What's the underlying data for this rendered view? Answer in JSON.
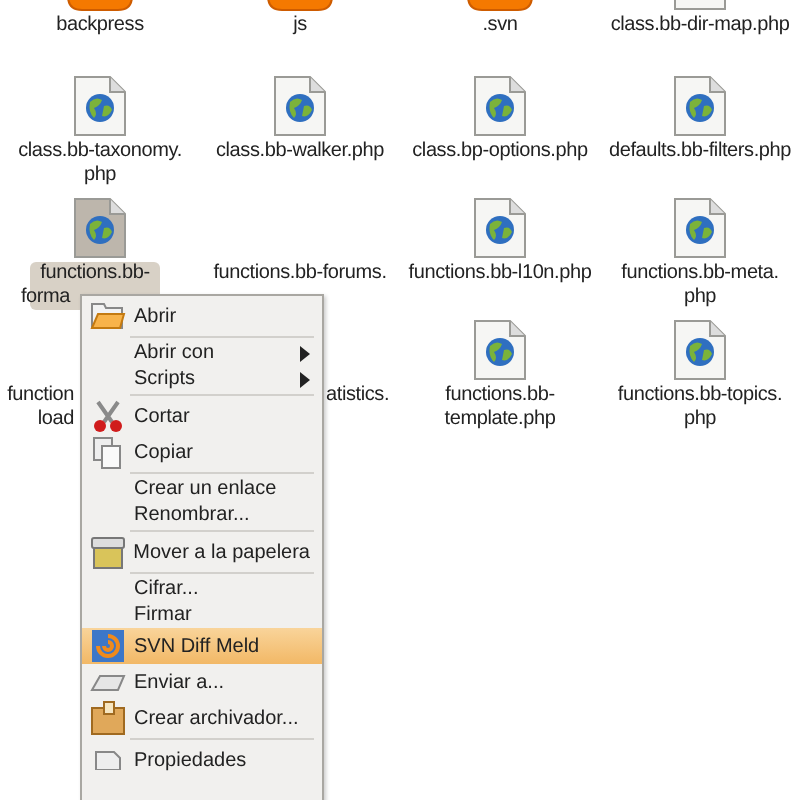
{
  "files": [
    {
      "kind": "folder",
      "selected": false,
      "lines": [
        {
          "text": "backpress"
        }
      ]
    },
    {
      "kind": "folder",
      "selected": false,
      "lines": [
        {
          "text": "js"
        }
      ]
    },
    {
      "kind": "folder",
      "selected": false,
      "lines": [
        {
          "text": ".svn"
        }
      ]
    },
    {
      "kind": "php",
      "selected": false,
      "lines": [
        {
          "text": "class.bb-dir-map.php"
        }
      ]
    },
    {
      "kind": "php",
      "selected": false,
      "lines": [
        {
          "text": "class.bb-taxonomy."
        },
        {
          "text": "php"
        }
      ]
    },
    {
      "kind": "php",
      "selected": false,
      "lines": [
        {
          "text": "class.bb-walker.php"
        }
      ]
    },
    {
      "kind": "php",
      "selected": false,
      "lines": [
        {
          "text": "class.bp-options.php"
        }
      ]
    },
    {
      "kind": "php",
      "selected": false,
      "lines": [
        {
          "text": "defaults.bb-filters.php"
        }
      ]
    },
    {
      "kind": "php",
      "selected": true,
      "lines": [
        {
          "text": "functions.bb-"
        },
        {
          "text": "forma"
        }
      ]
    },
    {
      "kind": "none",
      "selected": false,
      "lines": [
        {
          "text": "functions.bb-forums."
        }
      ]
    },
    {
      "kind": "php",
      "selected": false,
      "lines": [
        {
          "text": "functions.bb-l10n.php"
        }
      ]
    },
    {
      "kind": "php",
      "selected": false,
      "lines": [
        {
          "text": "functions.bb-meta."
        },
        {
          "text": "php"
        }
      ]
    },
    {
      "kind": "none",
      "selected": false,
      "lines": [
        {
          "text": "function"
        },
        {
          "text": "load"
        }
      ]
    },
    {
      "kind": "none",
      "selected": false,
      "lines": [
        {
          "text": "atistics."
        }
      ]
    },
    {
      "kind": "php",
      "selected": false,
      "lines": [
        {
          "text": "functions.bb-"
        },
        {
          "text": "template.php"
        }
      ]
    },
    {
      "kind": "php",
      "selected": false,
      "lines": [
        {
          "text": "functions.bb-topics."
        },
        {
          "text": "php"
        }
      ]
    }
  ],
  "menu": [
    {
      "kind": "open",
      "label": "Abrir",
      "selected": false
    },
    {
      "kind": "separator"
    },
    {
      "kind": "text",
      "label": "Abrir con",
      "submenu": true,
      "selected": false
    },
    {
      "kind": "text",
      "label": "Scripts",
      "submenu": true,
      "selected": false
    },
    {
      "kind": "separator"
    },
    {
      "kind": "cut",
      "label": "Cortar",
      "selected": false
    },
    {
      "kind": "copy",
      "label": "Copiar",
      "selected": false
    },
    {
      "kind": "separator"
    },
    {
      "kind": "text",
      "label": "Crear un enlace",
      "selected": false
    },
    {
      "kind": "text",
      "label": "Renombrar...",
      "selected": false
    },
    {
      "kind": "separator"
    },
    {
      "kind": "trash",
      "label": "Mover a la papelera",
      "selected": false
    },
    {
      "kind": "separator"
    },
    {
      "kind": "text",
      "label": "Cifrar...",
      "selected": false
    },
    {
      "kind": "text",
      "label": "Firmar",
      "selected": false
    },
    {
      "kind": "meld",
      "label": "SVN Diff Meld",
      "selected": true
    },
    {
      "kind": "send",
      "label": "Enviar a...",
      "selected": false
    },
    {
      "kind": "archive",
      "label": "Crear archivador...",
      "selected": false
    },
    {
      "kind": "separator"
    },
    {
      "kind": "properties",
      "label": "Propiedades",
      "selected": false
    }
  ]
}
